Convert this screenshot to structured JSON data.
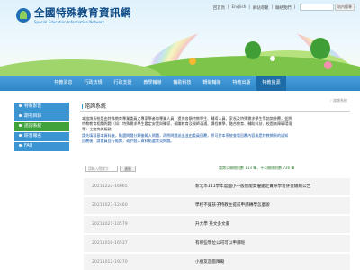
{
  "site": {
    "title": "全國特殊教育資訊網",
    "subtitle": "Special Education Information Network"
  },
  "toplinks": [
    "回首頁",
    "|",
    "English",
    "|",
    "網站導覽",
    "|",
    "聯絡我們",
    "|"
  ],
  "header_search": {
    "placeholder": "",
    "button_label": "站內搜尋"
  },
  "nav": {
    "items": [
      {
        "label": "特教消息",
        "active": false
      },
      {
        "label": "行政法規",
        "active": false
      },
      {
        "label": "行政支援",
        "active": false
      },
      {
        "label": "教學輔導",
        "active": false
      },
      {
        "label": "輔助科技",
        "active": false
      },
      {
        "label": "轉銜輔導",
        "active": false
      },
      {
        "label": "特教出版",
        "active": false
      },
      {
        "label": "特教資源",
        "active": true
      }
    ]
  },
  "sidebar": {
    "items": [
      {
        "label": "特教影音",
        "active": false
      },
      {
        "label": "期刊目錄",
        "active": false
      },
      {
        "label": "諮詢系統",
        "active": true
      },
      {
        "label": "研習報名",
        "active": false
      },
      {
        "label": "FAQ",
        "active": false
      }
    ]
  },
  "main": {
    "breadcrumb": "› 諮詢系統",
    "title": "諮詢系統",
    "intro_lines": [
      "本諮詢系統是由特殊教育專業委員之專家學者和專業人員，提供各類特教學生、輔導人員、家長及特殊需求學生等諮詢答覆，並將",
      "特教教育相關問題（如：特殊需求學生鑑定安置與輔導、親職教育及親師溝通、課程教學、融合教育、輔助科技、校園無障礙環境",
      "等）之諮詢與服務。",
      "請先填寫基本資料後，點選問題分類後輸入問題，再將問題送出並由委員回覆，將可於本系統查看回覆內容或是特教網頁的通知",
      "回覆後，請會員自行點閱，或於個人資料點選常見問題。"
    ],
    "search": {
      "placeholder": "請輸入關鍵字",
      "button_label": "送出"
    },
    "stats": "諮詢公開總則數 113 筆，不公開總則數 726 筆",
    "rows": [
      {
        "id": "20211222-16665",
        "title": "新北市111學年度國小一般智能資優鑑定實際學習評量總報公告"
      },
      {
        "id": "20211023-12460",
        "title": "學校不讓孩子特教生提前申請轉學怎麼辦"
      },
      {
        "id": "20211021-10579",
        "title": "升大學 英文多文書"
      },
      {
        "id": "20211016-16537",
        "title": "有哪些學位公司可以申請呢"
      },
      {
        "id": "20211012-19270",
        "title": "小朋友遊戲障礙"
      }
    ]
  },
  "colors": {
    "nav_bg": "#2f86c7",
    "nav_active": "#1d6ca8",
    "sidebar_item": "#3b95d3",
    "sidebar_active": "#3fa23a",
    "title_text": "#0c4a86"
  }
}
